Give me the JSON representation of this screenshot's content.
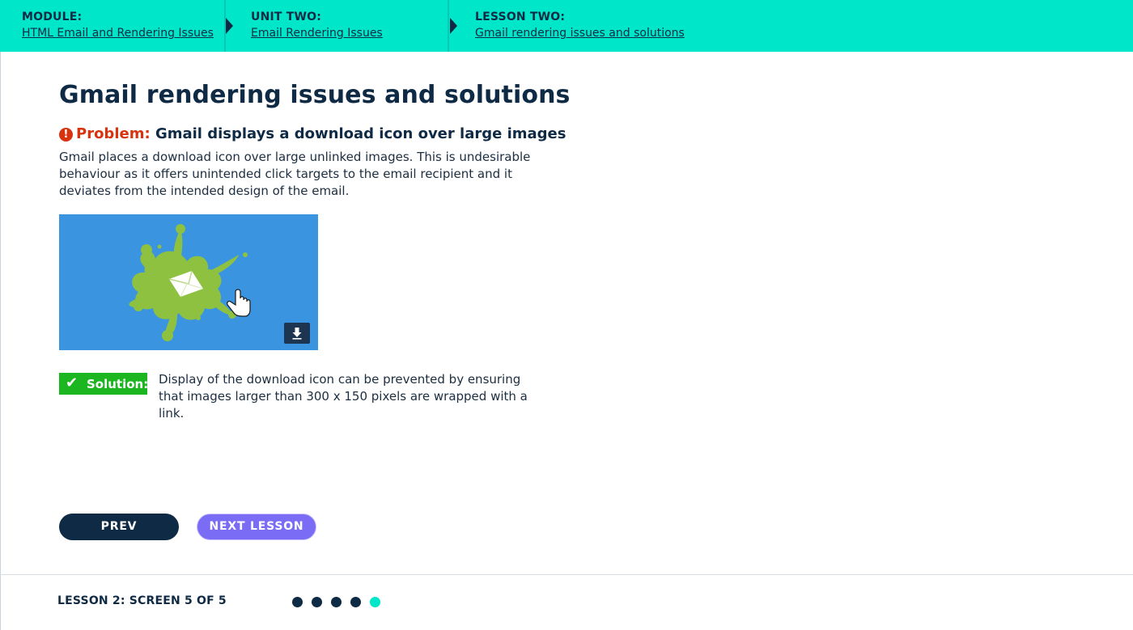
{
  "breadcrumb": {
    "module": {
      "label": "MODULE:",
      "link": "HTML Email and Rendering Issues"
    },
    "unit": {
      "label": "UNIT TWO:",
      "link": "Email Rendering Issues"
    },
    "lesson": {
      "label": "LESSON TWO:",
      "link": "Gmail rendering issues and solutions"
    }
  },
  "page": {
    "title": "Gmail rendering issues and solutions",
    "problem_label": "Problem:",
    "problem_text": "Gmail displays a download icon over large images",
    "description": "Gmail places a download icon over large unlinked images. This is undesirable behaviour as it offers unintended click targets to the email recipient and it deviates from the intended design of the email.",
    "illustration": {
      "icon": "envelope-splat-icon",
      "cursor": "hand-cursor-icon",
      "overlay_icon": "download-icon"
    },
    "solution_label": "Solution:",
    "solution_text": "Display of the download icon can be prevented by ensuring that images larger than 300 x 150 pixels are wrapped with a link."
  },
  "nav": {
    "prev": "PREV",
    "next": "NEXT LESSON"
  },
  "footer": {
    "progress_label": "LESSON 2: SCREEN 5 OF 5",
    "total_screens": 5,
    "current_screen": 5
  },
  "colors": {
    "accent": "#00e6c8",
    "navy": "#0f2a45",
    "problem": "#d7330f",
    "solution": "#1cb620",
    "next_button": "#7b6cf6",
    "illustration_bg": "#3a94e0",
    "splat": "#8fc140"
  }
}
